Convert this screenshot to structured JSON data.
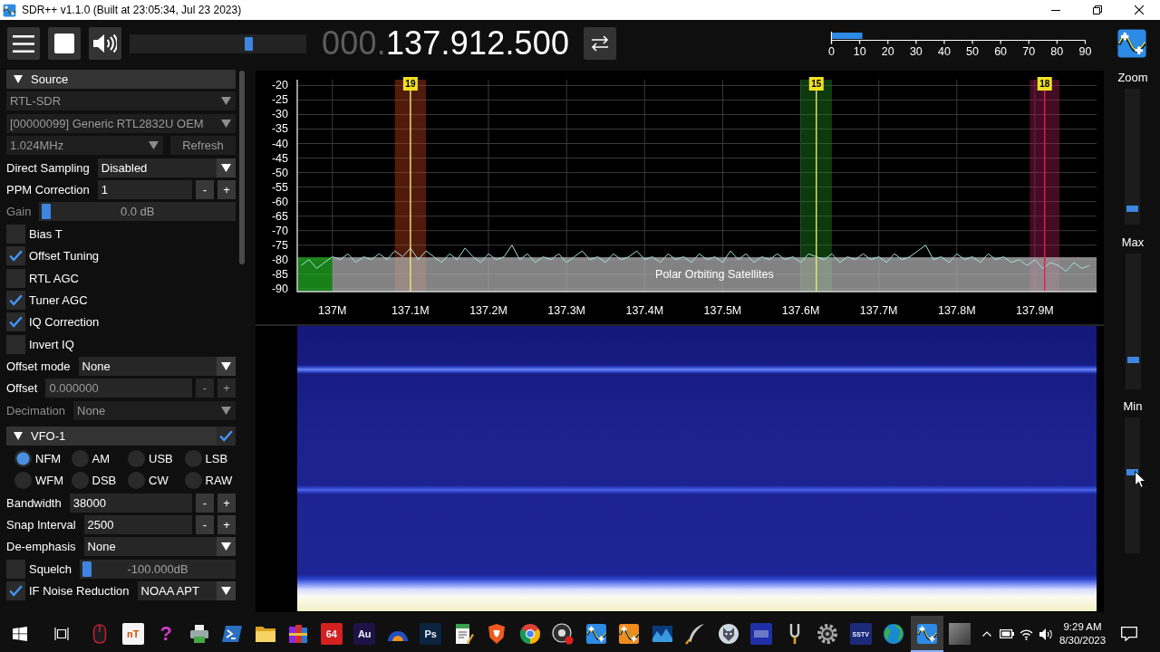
{
  "window": {
    "title": "SDR++ v1.1.0 (Built at 23:05:34, Jul 23 2023)"
  },
  "toolbar": {
    "playing": true,
    "volume": {
      "level": 0.69
    },
    "frequency": {
      "prefix": "000.",
      "value": "137.912.500"
    },
    "snr_meter": {
      "level": 0.12,
      "ticks": [
        "0",
        "10",
        "20",
        "30",
        "40",
        "50",
        "60",
        "70",
        "80",
        "90"
      ]
    }
  },
  "sidebar": {
    "sections": [
      {
        "title": "Source",
        "expanded": true,
        "rows": [
          {
            "kind": "combo",
            "value": "RTL-SDR",
            "disabled": true
          },
          {
            "kind": "combo",
            "value": "[00000099] Generic RTL2832U OEM",
            "disabled": true
          },
          {
            "kind": "combo_button",
            "value": "1.024MHz",
            "button": "Refresh",
            "disabled": true
          },
          {
            "kind": "combo",
            "label": "Direct Sampling",
            "label_disabled": false,
            "value": "Disabled",
            "disabled": false
          },
          {
            "kind": "stepper",
            "label": "PPM Correction",
            "label_disabled": false,
            "value": "1",
            "minus": "-",
            "plus": "+",
            "disabled": false
          },
          {
            "kind": "slider",
            "label": "Gain",
            "label_disabled": true,
            "value": "0.0 dB",
            "level": 0,
            "disabled": true
          },
          {
            "kind": "checkbox",
            "label": "Bias T",
            "checked": false
          },
          {
            "kind": "checkbox",
            "label": "Offset Tuning",
            "checked": true
          },
          {
            "kind": "checkbox",
            "label": "RTL AGC",
            "checked": false
          },
          {
            "kind": "checkbox",
            "label": "Tuner AGC",
            "checked": true
          },
          {
            "kind": "checkbox",
            "label": "IQ Correction",
            "checked": true
          },
          {
            "kind": "checkbox",
            "label": "Invert IQ",
            "checked": false
          },
          {
            "kind": "combo",
            "label": "Offset mode",
            "label_disabled": false,
            "value": "None",
            "disabled": false
          },
          {
            "kind": "stepper",
            "label": "Offset",
            "label_disabled": false,
            "value": "0.000000",
            "minus": "-",
            "plus": "+",
            "disabled": true
          },
          {
            "kind": "combo",
            "label": "Decimation",
            "label_disabled": true,
            "value": "None",
            "disabled": true
          }
        ]
      },
      {
        "title": "VFO-1",
        "expanded": true,
        "toggle": {
          "checked": true
        },
        "rows": [
          {
            "kind": "radio_group",
            "options": [
              {
                "label": "NFM",
                "selected": true
              },
              {
                "label": "AM",
                "selected": false
              },
              {
                "label": "USB",
                "selected": false
              },
              {
                "label": "LSB",
                "selected": false
              },
              {
                "label": "WFM",
                "selected": false
              },
              {
                "label": "DSB",
                "selected": false
              },
              {
                "label": "CW",
                "selected": false
              },
              {
                "label": "RAW",
                "selected": false
              }
            ]
          },
          {
            "kind": "stepper",
            "label": "Bandwidth",
            "label_disabled": false,
            "value": "38000",
            "minus": "-",
            "plus": "+",
            "disabled": false
          },
          {
            "kind": "stepper",
            "label": "Snap Interval",
            "label_disabled": false,
            "value": "2500",
            "minus": "-",
            "plus": "+",
            "disabled": false
          },
          {
            "kind": "combo",
            "label": "De-emphasis",
            "label_disabled": false,
            "value": "None",
            "disabled": false
          },
          {
            "kind": "checkbox_slider",
            "label": "Squelch",
            "checked": false,
            "value": "-100.000dB",
            "level": 0,
            "disabled": true
          },
          {
            "kind": "checkbox_combo",
            "label": "IF Noise Reduction",
            "checked": true,
            "value": "NOAA APT",
            "disabled": false
          }
        ]
      }
    ]
  },
  "spectrum": {
    "chart_data": {
      "type": "line",
      "color": "#a8e0e0",
      "grid": true,
      "xlim": [
        136.955,
        137.979
      ],
      "ylim": [
        -91,
        -18
      ],
      "x": [
        136.96,
        136.97,
        136.98,
        136.99,
        137.0,
        137.01,
        137.02,
        137.03,
        137.04,
        137.05,
        137.06,
        137.07,
        137.08,
        137.09,
        137.1,
        137.11,
        137.12,
        137.13,
        137.14,
        137.15,
        137.16,
        137.17,
        137.18,
        137.19,
        137.2,
        137.21,
        137.22,
        137.23,
        137.24,
        137.25,
        137.26,
        137.27,
        137.28,
        137.29,
        137.3,
        137.31,
        137.32,
        137.33,
        137.34,
        137.35,
        137.36,
        137.37,
        137.38,
        137.39,
        137.4,
        137.41,
        137.42,
        137.43,
        137.44,
        137.45,
        137.46,
        137.47,
        137.48,
        137.49,
        137.5,
        137.51,
        137.52,
        137.53,
        137.54,
        137.55,
        137.56,
        137.57,
        137.58,
        137.59,
        137.6,
        137.61,
        137.62,
        137.63,
        137.64,
        137.65,
        137.66,
        137.67,
        137.68,
        137.69,
        137.7,
        137.71,
        137.72,
        137.73,
        137.74,
        137.75,
        137.76,
        137.77,
        137.78,
        137.79,
        137.8,
        137.81,
        137.82,
        137.83,
        137.84,
        137.85,
        137.86,
        137.87,
        137.88,
        137.89,
        137.9,
        137.91,
        137.92,
        137.93,
        137.94,
        137.95,
        137.96,
        137.97
      ],
      "values": [
        -82,
        -80,
        -83,
        -81,
        -79,
        -80,
        -78,
        -81,
        -79,
        -80,
        -78,
        -80,
        -77,
        -79,
        -76,
        -80,
        -77,
        -79,
        -81,
        -78,
        -80,
        -76,
        -79,
        -81,
        -78,
        -80,
        -79,
        -75,
        -80,
        -78,
        -81,
        -79,
        -80,
        -78,
        -81,
        -79,
        -77,
        -80,
        -79,
        -81,
        -78,
        -80,
        -79,
        -77,
        -80,
        -79,
        -81,
        -78,
        -80,
        -79,
        -81,
        -78,
        -80,
        -79,
        -81,
        -77,
        -80,
        -78,
        -81,
        -79,
        -80,
        -78,
        -80,
        -79,
        -81,
        -78,
        -79,
        -80,
        -78,
        -81,
        -79,
        -80,
        -78,
        -80,
        -79,
        -81,
        -78,
        -80,
        -79,
        -77,
        -75,
        -80,
        -79,
        -81,
        -78,
        -80,
        -79,
        -81,
        -78,
        -80,
        -79,
        -81,
        -80,
        -82,
        -80,
        -83,
        -81,
        -82,
        -84,
        -81,
        -83,
        -82
      ],
      "xticks": [
        {
          "value": 137.0,
          "label": "137M"
        },
        {
          "value": 137.1,
          "label": "137.1M"
        },
        {
          "value": 137.2,
          "label": "137.2M"
        },
        {
          "value": 137.3,
          "label": "137.3M"
        },
        {
          "value": 137.4,
          "label": "137.4M"
        },
        {
          "value": 137.5,
          "label": "137.5M"
        },
        {
          "value": 137.6,
          "label": "137.6M"
        },
        {
          "value": 137.7,
          "label": "137.7M"
        },
        {
          "value": 137.8,
          "label": "137.8M"
        },
        {
          "value": 137.9,
          "label": "137.9M"
        }
      ],
      "yticks": [
        -20,
        -25,
        -30,
        -35,
        -40,
        -45,
        -50,
        -55,
        -60,
        -65,
        -70,
        -75,
        -80,
        -85,
        -90
      ],
      "bands": [
        {
          "axis": "x",
          "from": 137.08,
          "to": 137.12,
          "label": "19",
          "color": "#c0401a"
        },
        {
          "axis": "x",
          "from": 137.6,
          "to": 137.64,
          "label": "15",
          "color": "#1c8a1c"
        },
        {
          "axis": "x",
          "from": 137.8935,
          "to": 137.9315,
          "label": "18",
          "color": "#a01c50"
        },
        {
          "axis": "x",
          "from": 136.955,
          "to": 137.0,
          "color": "#22b022"
        },
        {
          "axis": "x",
          "from": 137.0,
          "to": 137.979,
          "label": "Polar Orbiting Satellites",
          "color": "#b4b4b4"
        }
      ],
      "ref_lines": [
        {
          "axis": "x",
          "value": 137.1,
          "color": "#e8e870"
        },
        {
          "axis": "x",
          "value": 137.62,
          "color": "#e8e870"
        },
        {
          "axis": "x",
          "value": 137.9125,
          "color": "#e0204a"
        }
      ]
    }
  },
  "display_controls": [
    {
      "label": "Zoom",
      "level": 0.1
    },
    {
      "label": "Max",
      "level": 0.2
    },
    {
      "label": "Min",
      "level": 0.6
    }
  ],
  "taskbar": {
    "apps": [
      {
        "kind": "mouse",
        "selected": false
      },
      {
        "kind": "tile",
        "text": "nT",
        "color": "#f4f4f4",
        "selected": false
      },
      {
        "kind": "glyph",
        "text": "?",
        "color": "#d23cc8",
        "selected": false
      },
      {
        "kind": "printer",
        "selected": false
      },
      {
        "kind": "terminal",
        "selected": false
      },
      {
        "kind": "folder",
        "selected": false
      },
      {
        "kind": "books",
        "selected": false
      },
      {
        "kind": "tile",
        "text": "64",
        "color": "#d42020",
        "selected": false
      },
      {
        "kind": "tile",
        "text": "Au",
        "color": "#1d1346",
        "selected": false
      },
      {
        "kind": "dome",
        "selected": false
      },
      {
        "kind": "tile",
        "text": "Ps",
        "color": "#0b2440",
        "selected": false
      },
      {
        "kind": "notepad",
        "selected": false
      },
      {
        "kind": "shield",
        "selected": false
      },
      {
        "kind": "round",
        "selected": false
      },
      {
        "kind": "record",
        "selected": false
      },
      {
        "kind": "wave_tile",
        "color": "#2d8ae5",
        "selected": false
      },
      {
        "kind": "wave_tile",
        "color": "#f08c1e",
        "selected": false
      },
      {
        "kind": "wave",
        "selected": false
      },
      {
        "kind": "quill",
        "selected": false
      },
      {
        "kind": "head",
        "selected": false
      },
      {
        "kind": "tile",
        "color": "#1e2fa8",
        "selected": false
      },
      {
        "kind": "fork",
        "selected": false
      },
      {
        "kind": "gear",
        "selected": false
      },
      {
        "kind": "tile",
        "text": "SSTV",
        "color": "#1c2a7a",
        "selected": false
      },
      {
        "kind": "globe",
        "selected": false
      },
      {
        "kind": "wave_tile",
        "color": "#2d8ae5",
        "selected": true
      },
      {
        "kind": "photo",
        "selected": false
      }
    ],
    "clock": {
      "time": "9:29 AM",
      "date": "8/30/2023"
    }
  }
}
